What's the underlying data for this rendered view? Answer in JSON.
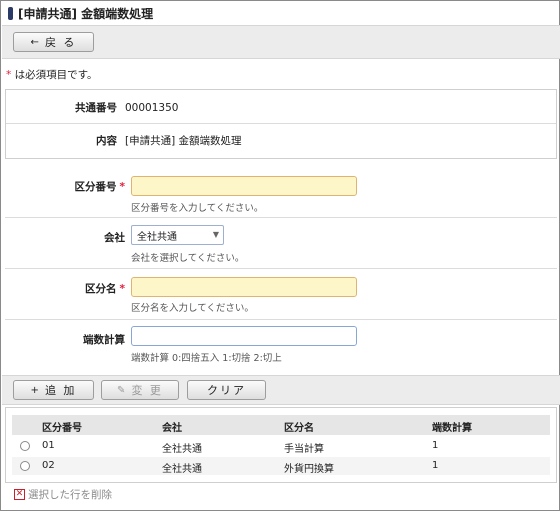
{
  "page": {
    "title": "[申請共通] 金額端数処理"
  },
  "toolbar": {
    "back_label": "戻 る",
    "back_icon": "←"
  },
  "required_note": {
    "star": "*",
    "text": "は必須項目です。"
  },
  "info": {
    "rows": [
      {
        "label": "共通番号",
        "value": "00001350"
      },
      {
        "label": "内容",
        "value": "[申請共通] 金額端数処理"
      }
    ]
  },
  "form": {
    "kubun_no": {
      "label": "区分番号",
      "star": "*",
      "value": "",
      "placeholder": "",
      "hint": "区分番号を入力してください。"
    },
    "company": {
      "label": "会社",
      "selected": "全社共通",
      "hint": "会社を選択してください。"
    },
    "kubun_name": {
      "label": "区分名",
      "star": "*",
      "value": "",
      "placeholder": "",
      "hint": "区分名を入力してください。"
    },
    "rounding": {
      "label": "端数計算",
      "value": "",
      "placeholder": "",
      "hint": "端数計算 0:四捨五入 1:切捨 2:切上"
    }
  },
  "actions": {
    "add_label": "追 加",
    "add_icon": "+",
    "update_label": "変 更",
    "update_icon": "✎",
    "clear_label": "クリア"
  },
  "table": {
    "headers": [
      "区分番号",
      "会社",
      "区分名",
      "端数計算"
    ],
    "rows": [
      {
        "no": "01",
        "company": "全社共通",
        "name": "手当計算",
        "rounding": "1"
      },
      {
        "no": "02",
        "company": "全社共通",
        "name": "外貨円換算",
        "rounding": "1"
      }
    ]
  },
  "delete": {
    "icon": "✕",
    "label": "選択した行を削除"
  },
  "colors": {
    "accent": "#2b3a67",
    "required": "#e0213c",
    "required_field_bg": "#fdf6c8"
  }
}
